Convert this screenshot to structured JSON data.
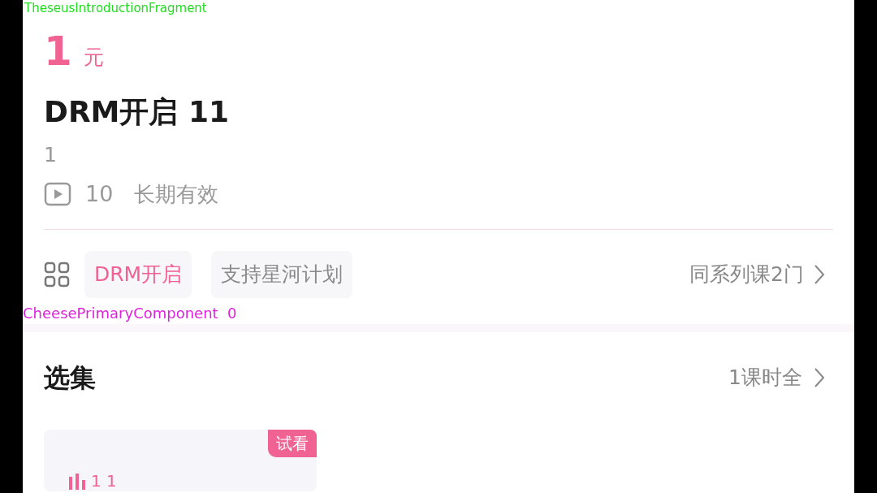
{
  "debug_labels": [
    {
      "text": "TheseusIntroductionFragment",
      "color": "#22dd22"
    },
    {
      "text": "CheesePrimaryComponent  0",
      "color": "#dd22dd"
    }
  ],
  "price": {
    "amount": "1",
    "unit": "元"
  },
  "title": "DRM开启 11",
  "subtitle": "1",
  "meta": {
    "count": "10",
    "validity": "长期有效"
  },
  "tags": [
    {
      "label": "DRM开启",
      "color": "#f06292"
    },
    {
      "label": "支持星河计划",
      "color": "#8a8a8a"
    }
  ],
  "series_link": "同系列课2门",
  "episodes": {
    "heading": "选集",
    "summary": "1课时全",
    "items": [
      {
        "badge": "试看",
        "label": "1 1"
      }
    ]
  }
}
